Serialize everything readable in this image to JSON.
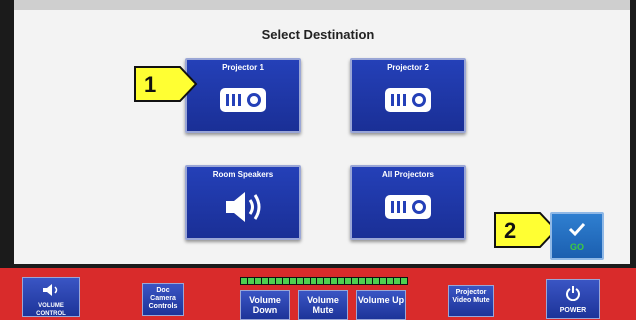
{
  "screen": {
    "title": "Select Destination"
  },
  "destinations": [
    {
      "label": "Projector 1",
      "icon": "projector-icon"
    },
    {
      "label": "Projector 2",
      "icon": "projector-icon"
    },
    {
      "label": "Room Speakers",
      "icon": "speaker-icon"
    },
    {
      "label": "All Projectors",
      "icon": "projector-icon"
    }
  ],
  "go": {
    "label": "GO",
    "icon": "checkmark-icon"
  },
  "callouts": [
    "1",
    "2"
  ],
  "bottom_bar": {
    "volume_control": "VOLUME CONTROL",
    "doc_camera": "Doc Camera Controls",
    "volume_down": "Volume Down",
    "volume_mute": "Volume Mute",
    "volume_up": "Volume Up",
    "projector_video_mute": "Projector Video Mute",
    "power": "POWER"
  },
  "colors": {
    "button_blue": "#2440b8",
    "bar_red": "#d92b2b",
    "callout_yellow": "#ffff33",
    "go_green": "#3ecb3e"
  }
}
